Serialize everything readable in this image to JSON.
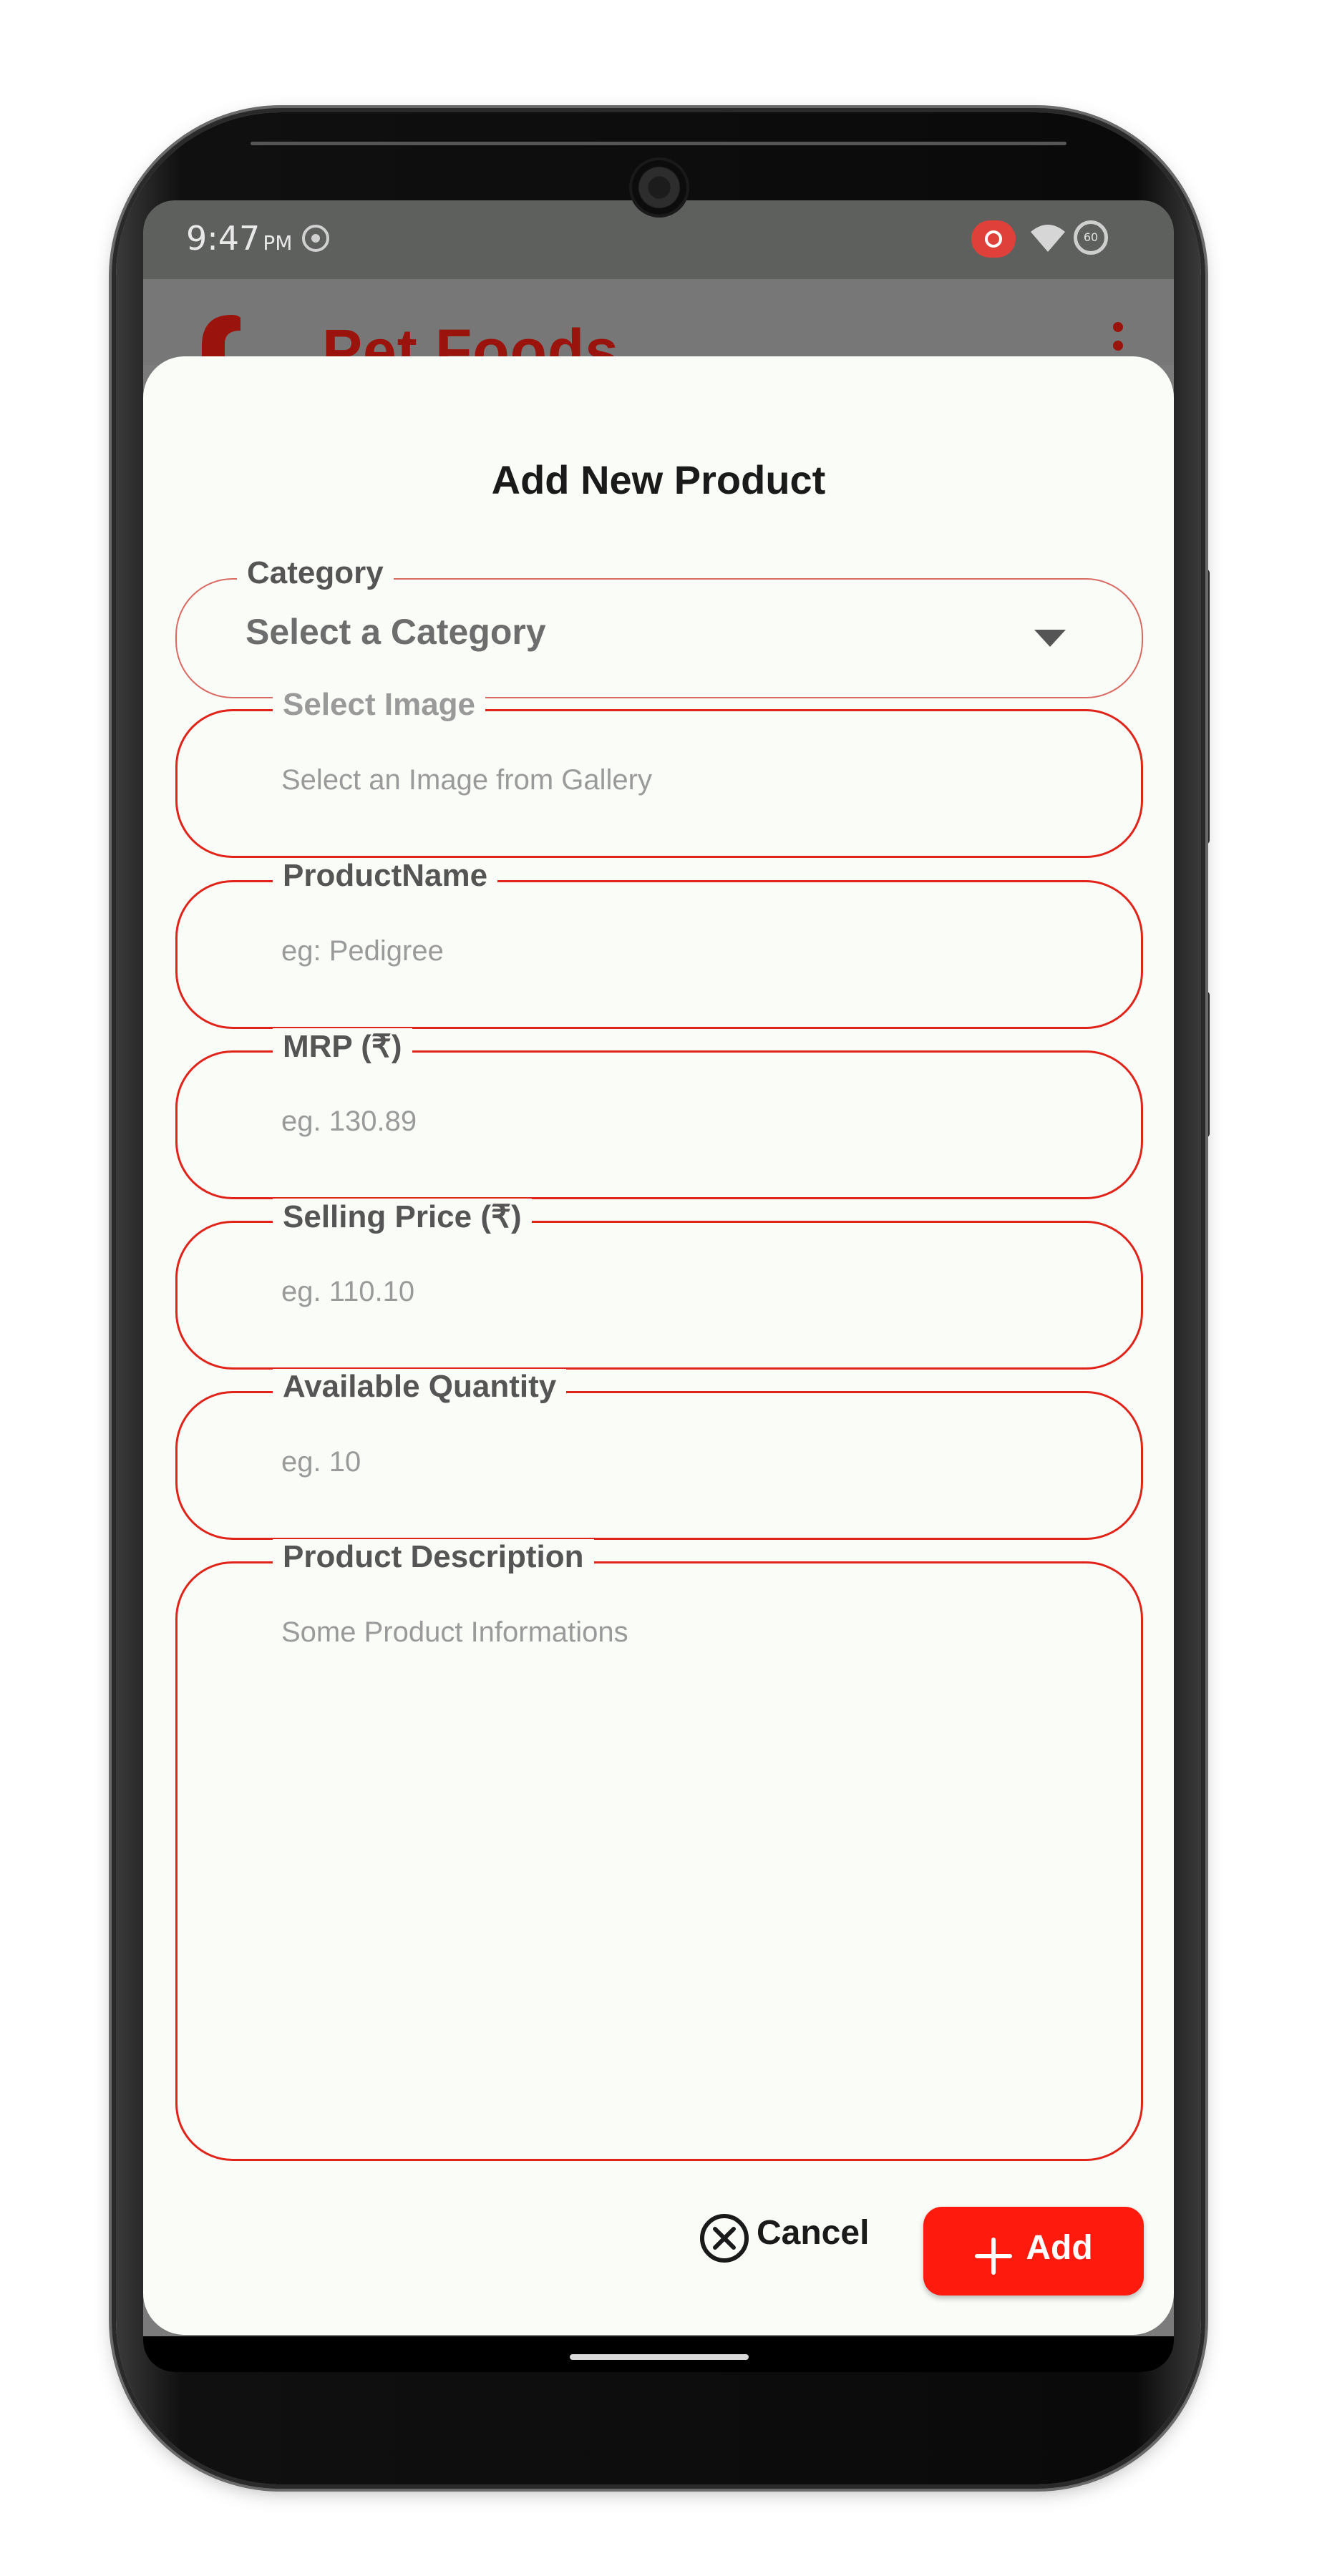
{
  "status_bar": {
    "time": "9:47",
    "ampm": "PM",
    "battery": "60"
  },
  "app": {
    "title": "Pet Foods"
  },
  "dialog": {
    "title": "Add New Product",
    "category": {
      "label": "Category",
      "value": "Select a Category"
    },
    "image": {
      "label": "Select Image",
      "placeholder": "Select an Image from Gallery"
    },
    "product_name": {
      "label": "ProductName",
      "placeholder": "eg: Pedigree"
    },
    "mrp": {
      "label": "MRP (₹)",
      "placeholder": "eg. 130.89"
    },
    "selling_price": {
      "label": "Selling Price (₹)",
      "placeholder": "eg. 110.10"
    },
    "quantity": {
      "label": "Available Quantity",
      "placeholder": "eg. 10"
    },
    "description": {
      "label": "Product Description",
      "placeholder": "Some Product Informations"
    },
    "cancel_label": "Cancel",
    "add_label": "Add"
  },
  "colors": {
    "accent": "#e0241a",
    "add_button": "#ff1a0e",
    "app_title": "#9a140d",
    "dialog_bg": "#fafcf8"
  }
}
